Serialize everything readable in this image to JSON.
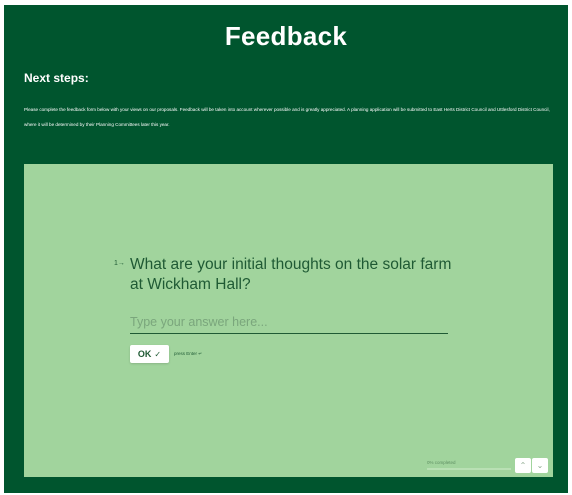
{
  "header": {
    "title": "Feedback"
  },
  "section": {
    "heading": "Next steps:",
    "intro": "Please complete the feedback form below with your views on our proposals. Feedback will be taken into account wherever possible and is greatly appreciated. A planning application will be submitted to East Herts District Council and Uttlesford District Council, where it will be determined by their Planning Committees later this year."
  },
  "form": {
    "question_arrow": "1→",
    "question": "What are your initial thoughts on the solar farm at Wickham Hall?",
    "answer_value": "",
    "answer_placeholder": "Type your answer here...",
    "ok_label": "OK",
    "ok_check": "✓",
    "press_enter": "press Enter ↵"
  },
  "footer": {
    "progress_text": "0% completed",
    "progress_fraction": 0.0,
    "nav_up": "⌃",
    "nav_down": "⌄"
  },
  "colors": {
    "page_bg": "#00552e",
    "panel_bg": "#a1d49d",
    "text_dark": "#1f5a34"
  }
}
